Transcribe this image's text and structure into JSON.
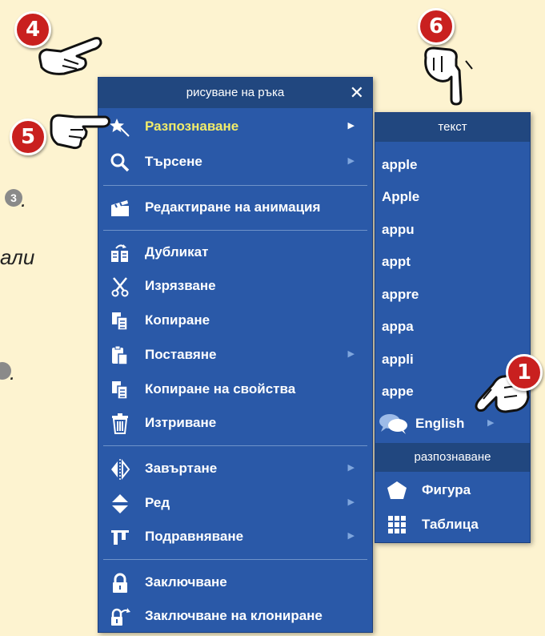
{
  "background_fragments": {
    "frag_a": ".",
    "frag_b": "али",
    "frag_c": ".",
    "circle_a": "3"
  },
  "menu": {
    "title": "рисуване на ръка",
    "close_label": "✕",
    "items": [
      {
        "label": "Разпознаване",
        "icon": "recognize-star-icon",
        "has_arrow": true,
        "highlighted": true
      },
      {
        "label": "Търсене",
        "icon": "search-icon",
        "has_arrow": true
      },
      {
        "label": "Редактиране на анимация",
        "icon": "clapperboard-icon",
        "has_arrow": false
      },
      {
        "label": "Дубликат",
        "icon": "duplicate-icon",
        "has_arrow": false
      },
      {
        "label": "Изрязване",
        "icon": "scissors-icon",
        "has_arrow": false
      },
      {
        "label": "Копиране",
        "icon": "copy-icon",
        "has_arrow": false
      },
      {
        "label": "Поставяне",
        "icon": "paste-icon",
        "has_arrow": true
      },
      {
        "label": "Копиране на свойства",
        "icon": "copy-properties-icon",
        "has_arrow": false
      },
      {
        "label": "Изтриване",
        "icon": "trash-icon",
        "has_arrow": false
      },
      {
        "label": "Завъртане",
        "icon": "rotate-icon",
        "has_arrow": true
      },
      {
        "label": "Ред",
        "icon": "order-icon",
        "has_arrow": true
      },
      {
        "label": "Подравняване",
        "icon": "align-icon",
        "has_arrow": true
      },
      {
        "label": "Заключване",
        "icon": "lock-icon",
        "has_arrow": false
      },
      {
        "label": "Заключване на клониране",
        "icon": "lock-clone-icon",
        "has_arrow": false
      }
    ]
  },
  "submenu": {
    "header_text": "текст",
    "suggestions": [
      "apple",
      "Apple",
      "appu",
      "appt",
      "appre",
      "appa",
      "appli",
      "appe"
    ],
    "language": "English",
    "header_recognize": "разпознаване",
    "shape_label": "Фигура",
    "table_label": "Таблица"
  },
  "callouts": [
    "1",
    "4",
    "5",
    "6"
  ],
  "colors": {
    "menu_bg": "#2a59a8",
    "menu_header": "#21477f",
    "highlight_text": "#f1ec6a",
    "callout": "#c9201f",
    "page_bg": "#fdf3d0"
  }
}
